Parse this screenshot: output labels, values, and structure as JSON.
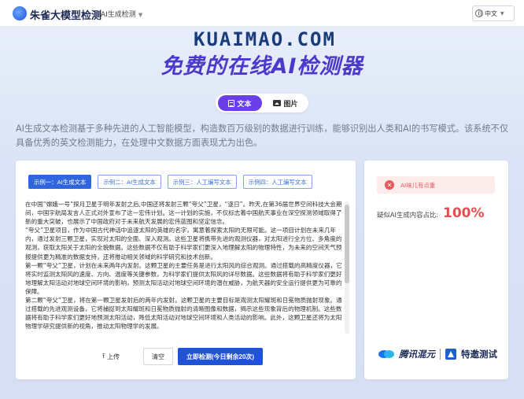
{
  "header": {
    "logo_text": "朱雀大模型检测",
    "nav_item": "AI生成检测",
    "lang": "中文"
  },
  "brand": {
    "logo_text": "KUAIMAO.COM",
    "title": "免费的在线AI检测器"
  },
  "mode_toggle": {
    "text_label": "文本",
    "image_label": "图片"
  },
  "description": "AI生成文本检测基于多种先进的人工智能模型，构造数百万级别的数据进行训练，能够识别出人类和AI的书写模式。该系统不仅具备优秀的英文检测能力，在处理中文数据方面表现尤为出色。",
  "examples": [
    "示例一：AI生成文本",
    "示例二：AI生成文本",
    "示例三：人工编写文本",
    "示例四：人工编写文本"
  ],
  "text_content": [
    "在中国“嫦娥一号”探月卫星于明年发射之后,中国还将发射三颗“夸父”卫星，“逐日”。昨天,在第36届世界空间科技大会期间，中国宇航局发言人正式对外宣布了这一宏伟计划。这一计划的实施，不仅标志着中国航天事业在深空探测领域取得了新的重大突破，也展示了中国政府对于未来航天发展的宏伟蓝图和坚定信念。",
    "“夸父”卫星项目，作为中国古代神话中追逐太阳的英雄的名字，寓意着探索太阳的无限可能。这一项目计划在未来几年内，通过发射三颗卫星，实现对太阳的全面、深入观测。这些卫星将携带先进的观测仪器，对太阳进行全方位、多角度的观测，获取太阳关于太阳的全貌数据。这些数据不仅有助于科学家们更深入地理解太阳的物理特性，为未来的空间天气预报提供更为精准的数据支持，还将推动相关领域的科学研究和技术创新。",
    "第一颗“夸父”卫星，计划在未来两年内发射。这颗卫星的主要任务是进行太阳风的综合观测。通过搭载的高精度仪器，它将实时监测太阳风的速度、方向、温度等关键参数，为科学家们提供太阳风的详尽数据。这些数据将有助于科学家们更好地理解太阳活动对地球空间环境的影响，预测太阳活动对地球空间环境的潜在威胁，为航天器的安全运行提供更为可靠的保障。",
    "第二颗“夸父”卫星，将在第一颗卫星发射后的两年内发射。这颗卫星的主要目标是观测太阳耀斑和日冕物质抛射现象。通过搭载的先进观测设备，它将捕捉到太阳耀斑和日冕物质抛射的清晰图像和数据，揭示这些现象背后的物理机制。这些数据将有助于科学家们更好地预测太阳活动，降低太阳活动对地球空间环境和人类活动的影响。此外，这颗卫星还将为太阳物理学研究提供新的视角，推动太阳物理学的发展。"
  ],
  "actions": {
    "upload": "上传",
    "clear": "清空",
    "detect": "立即检测(今日剩余20次)"
  },
  "result": {
    "alert_text": "AI味儿有点重",
    "prob_label": "疑似AI生成内容占比:",
    "prob_value": "100%",
    "prob_fraction": 1.0
  },
  "partners": {
    "p1": "腾讯混元",
    "p2": "特邀测试"
  },
  "colors": {
    "accent_purple": "#6a40e6",
    "primary_blue": "#1f52d8",
    "danger_red": "#e24f4f"
  }
}
